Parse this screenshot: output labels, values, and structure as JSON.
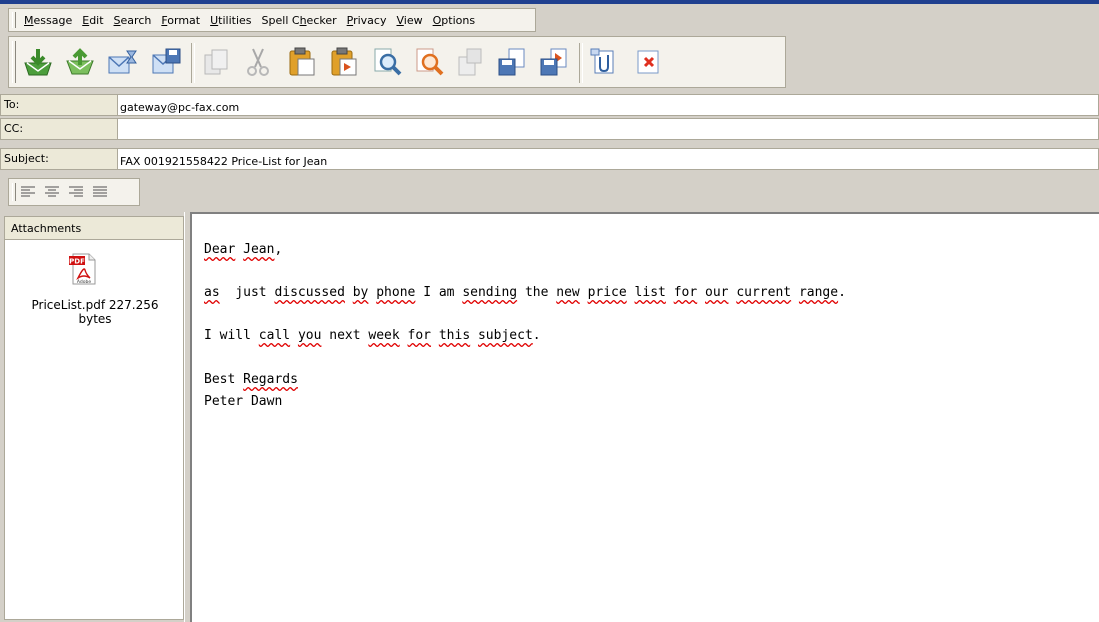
{
  "menu": [
    {
      "before": "",
      "key": "M",
      "after": "essage"
    },
    {
      "before": "",
      "key": "E",
      "after": "dit"
    },
    {
      "before": "",
      "key": "S",
      "after": "earch"
    },
    {
      "before": "",
      "key": "F",
      "after": "ormat"
    },
    {
      "before": "",
      "key": "U",
      "after": "tilities"
    },
    {
      "before": "Spell C",
      "key": "h",
      "after": "ecker"
    },
    {
      "before": "",
      "key": "P",
      "after": "rivacy"
    },
    {
      "before": "",
      "key": "V",
      "after": "iew"
    },
    {
      "before": "",
      "key": "O",
      "after": "ptions"
    }
  ],
  "toolbar_icons": [
    "send-icon",
    "upload-icon",
    "send-later-icon",
    "save-draft-icon",
    "copy-icon",
    "cut-icon",
    "paste-icon",
    "paste-special-icon",
    "find-icon",
    "find-replace-icon",
    "insert-icon",
    "save-icon",
    "save-as-icon",
    "attach-icon",
    "discard-icon"
  ],
  "fields": {
    "to_label": "To:",
    "to_value": "gateway@pc-fax.com",
    "cc_label": "CC:",
    "cc_value": "",
    "subject_label": "Subject:",
    "subject_value": "FAX 001921558422 Price-List for Jean"
  },
  "align_icons": [
    "align-left-icon",
    "align-center-icon",
    "align-right-icon",
    "justify-icon"
  ],
  "attachments": {
    "tab_label": "Attachments",
    "file_caption_line1": "PriceList.pdf 227.256",
    "file_caption_line2": "bytes",
    "icon_badge": "PDF",
    "icon_brand": "Adobe"
  },
  "body": {
    "line1": "Dear Jean,",
    "line2": "as  just discussed by phone I am sending the new price list for our current range.",
    "line3": "I will call you next week for this subject.",
    "line4": "Best Regards",
    "line5": "Peter Dawn"
  },
  "colors": {
    "spell_underline": "#e00000",
    "title_bar": "#1f3f8f"
  }
}
